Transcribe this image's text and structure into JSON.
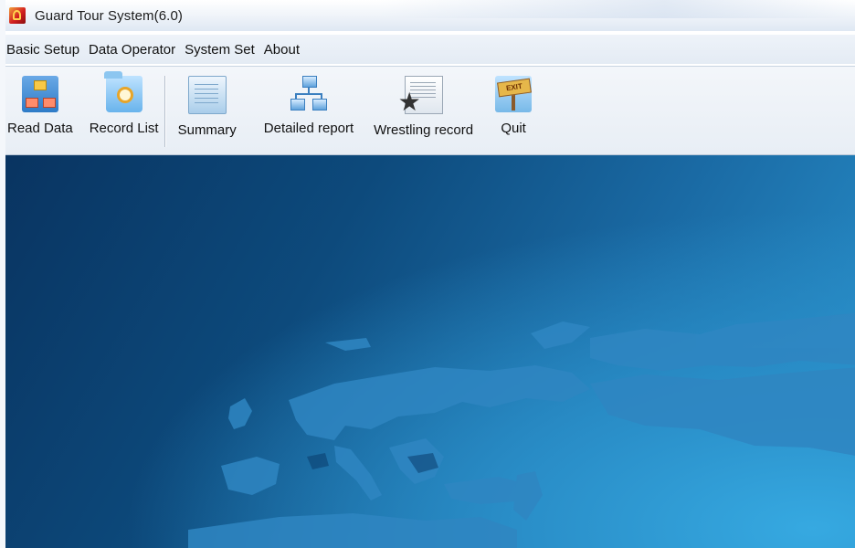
{
  "window": {
    "title": "Guard Tour System(6.0)"
  },
  "menu": {
    "items": [
      {
        "label": "Basic Setup"
      },
      {
        "label": "Data Operator"
      },
      {
        "label": "System Set"
      },
      {
        "label": "About"
      }
    ]
  },
  "toolbar": {
    "read_data": {
      "label": "Read Data",
      "icon": "read-data-icon"
    },
    "record_list": {
      "label": "Record List",
      "icon": "record-list-icon"
    },
    "summary": {
      "label": "Summary",
      "icon": "summary-icon"
    },
    "detailed_report": {
      "label": "Detailed report",
      "icon": "detailed-report-icon"
    },
    "wrestling_record": {
      "label": "Wrestling record",
      "icon": "wrestling-record-icon"
    },
    "quit": {
      "label": "Quit",
      "icon": "exit-sign-icon",
      "sign_text": "EXIT"
    }
  },
  "colors": {
    "workspace_dark": "#093461",
    "workspace_light": "#36a9e1",
    "land": "#2f86c2"
  }
}
